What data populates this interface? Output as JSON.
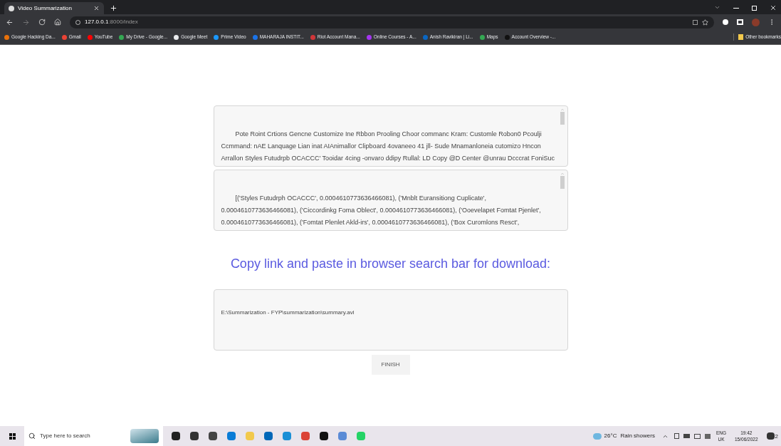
{
  "browser": {
    "tabs": [
      {
        "title": "Video Summarization",
        "selected": true
      }
    ],
    "address": {
      "host": "127.0.0.1",
      "path": ":8000/index"
    },
    "bookmarks": [
      "Google Hacking Da...",
      "Gmail",
      "YouTube",
      "My Drive - Google...",
      "Google Meet",
      "Prime Video",
      "MAHARAJA INSTIT...",
      "Riot Account Mana...",
      "Online Courses - A...",
      "Anish Ravikiran | Li...",
      "Maps",
      "Account Overview -..."
    ],
    "other_bookmarks": "Other bookmarks"
  },
  "page": {
    "text_panels": [
      {
        "lines": [
          "Pote Roint Crtions Gencne Customize Ine Rbbon Prooling Choor commanc Kram: Customle Robon0 Pcoulji",
          "Ccmmand: nAE Lanquage Lian inat AIAnimallor Clipboard 4ovaneeo 41 jll- Sude Mnamanloneia cutomizo Hncon",
          "Arrallon Styles Futudrpb OCACCC' Tooidar 4cing -onvaro ddipy Rullal: LD Copy @D Center @unrau Dcccrat FoniSuc"
        ]
      },
      {
        "lines": [
          "[('Styles Futudrph OCACCC', 0.0004610773636466081), ('Mnblt Euransitiong Cuplicate',",
          "0.0004610773636466081), ('Ciccordinkg Foma Oblect', 0.0004610773636466081), ('Ooevelapet Fomtat Pjenlet',",
          "0.0004610773636466081), ('Fomtat Plenlet Akld-irs', 0.0004610773636466081), ('Box Curomlons Resct',"
        ]
      }
    ],
    "heading": "Copy link and paste in browser search bar for download:",
    "link_path": "E:\\Summarization - FYP\\summarization\\summary.avi",
    "finish_button": "FINISH"
  },
  "taskbar": {
    "search_placeholder": "Type here to search",
    "weather_temp": "26°C",
    "weather_text": "Rain showers",
    "language": "ENG",
    "region": "UK",
    "time": "19:42",
    "date": "15/06/2022",
    "notifications": "2"
  }
}
